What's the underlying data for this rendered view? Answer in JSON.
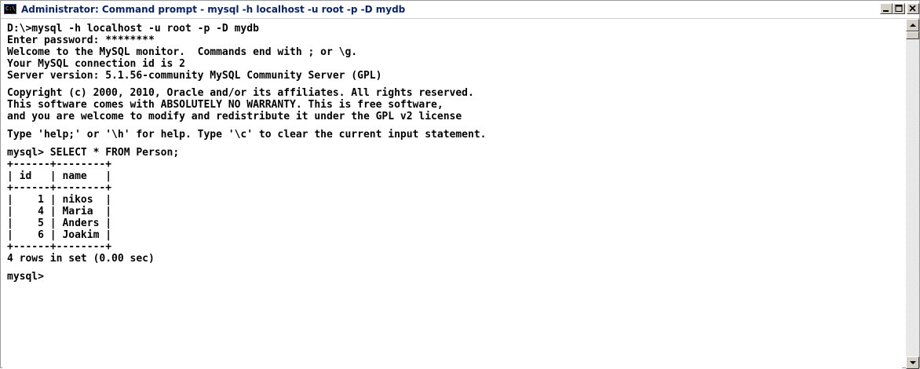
{
  "window": {
    "title": "Administrator: Command prompt - mysql  -h localhost -u root -p -D mydb",
    "icon": "cmd-icon",
    "icon_text": "C:\\"
  },
  "controls": {
    "minimize": "minimize-icon",
    "maximize": "maximize-icon",
    "close": "close-icon"
  },
  "console": {
    "lines": [
      "D:\\>mysql -h localhost -u root -p -D mydb",
      "Enter password: ********",
      "Welcome to the MySQL monitor.  Commands end with ; or \\g.",
      "Your MySQL connection id is 2",
      "Server version: 5.1.56-community MySQL Community Server (GPL)",
      "Copyright (c) 2000, 2010, Oracle and/or its affiliates. All rights reserved.",
      "This software comes with ABSOLUTELY NO WARRANTY. This is free software,",
      "and you are welcome to modify and redistribute it under the GPL v2 license",
      "Type 'help;' or '\\h' for help. Type '\\c' to clear the current input statement.",
      "mysql> SELECT * FROM Person;",
      "+------+--------+",
      "| id   | name   |",
      "+------+--------+",
      "|    1 | nikos  |",
      "|    4 | Maria  |",
      "|    5 | Anders |",
      "|    6 | Joakim |",
      "+------+--------+",
      "4 rows in set (0.00 sec)",
      "mysql>"
    ]
  },
  "scrollbar": {
    "up": "scroll-up-arrow-icon",
    "down": "scroll-down-arrow-icon"
  }
}
